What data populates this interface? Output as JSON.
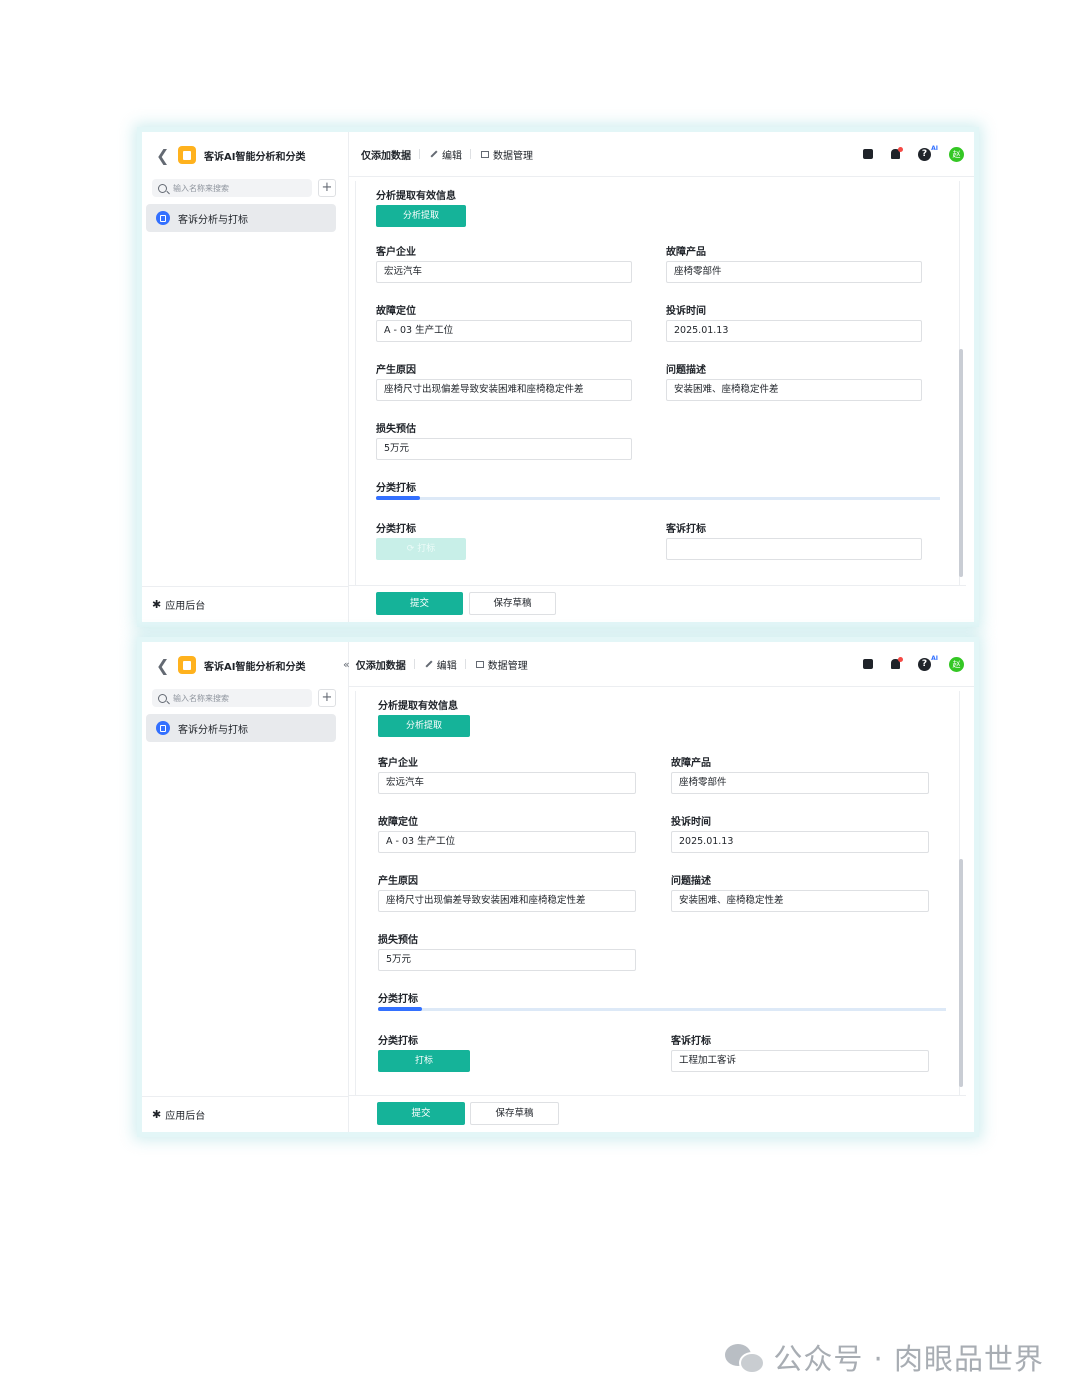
{
  "screens": [
    {
      "app_title": "客诉AI智能分析和分类",
      "search_placeholder": "输入名称来搜索",
      "nav_item": "客诉分析与打标",
      "footer_label": "应用后台",
      "toolbar": {
        "add_only": "仅添加数据",
        "edit": "编辑",
        "data_manage": "数据管理"
      },
      "avatar_text": "赵",
      "help_badge": "AI",
      "form": {
        "section_title": "分析提取有效信息",
        "analyze_button": "分析提取",
        "fields": [
          {
            "label": "客户企业",
            "value": "宏远汽车"
          },
          {
            "label": "故障产品",
            "value": "座椅零部件"
          },
          {
            "label": "故障定位",
            "value": "A - 03 生产工位"
          },
          {
            "label": "投诉时间",
            "value": "2025.01.13"
          },
          {
            "label": "产生原因",
            "value": "座椅尺寸出现偏差导致安装困难和座椅稳定件差"
          },
          {
            "label": "问题描述",
            "value": "安装困难、座椅稳定件差"
          },
          {
            "label": "损失预估",
            "value": "5万元"
          }
        ],
        "tab_label": "分类打标",
        "classify_label": "分类打标",
        "classify_button": "打标",
        "classify_button_state": "loading",
        "complaint_tag_label": "客诉打标",
        "complaint_tag_value": ""
      },
      "submit_button": "提交",
      "draft_button": "保存草稿"
    },
    {
      "app_title": "客诉AI智能分析和分类",
      "search_placeholder": "输入名称来搜索",
      "nav_item": "客诉分析与打标",
      "footer_label": "应用后台",
      "toolbar": {
        "add_only": "仅添加数据",
        "edit": "编辑",
        "data_manage": "数据管理"
      },
      "avatar_text": "赵",
      "help_badge": "AI",
      "form": {
        "section_title": "分析提取有效信息",
        "analyze_button": "分析提取",
        "fields": [
          {
            "label": "客户企业",
            "value": "宏远汽车"
          },
          {
            "label": "故障产品",
            "value": "座椅零部件"
          },
          {
            "label": "故障定位",
            "value": "A - 03 生产工位"
          },
          {
            "label": "投诉时间",
            "value": "2025.01.13"
          },
          {
            "label": "产生原因",
            "value": "座椅尺寸出现偏差导致安装困难和座椅稳定性差"
          },
          {
            "label": "问题描述",
            "value": "安装困难、座椅稳定性差"
          },
          {
            "label": "损失预估",
            "value": "5万元"
          }
        ],
        "tab_label": "分类打标",
        "classify_label": "分类打标",
        "classify_button": "打标",
        "classify_button_state": "enabled",
        "complaint_tag_label": "客诉打标",
        "complaint_tag_value": "工程加工客诉"
      },
      "submit_button": "提交",
      "draft_button": "保存草稿"
    }
  ],
  "watermark": "公众号 · 肉眼品世界",
  "colors": {
    "teal": "#15b399",
    "blue": "#3370ff",
    "app_icon": "#ffb21e",
    "avatar": "#34c724"
  }
}
